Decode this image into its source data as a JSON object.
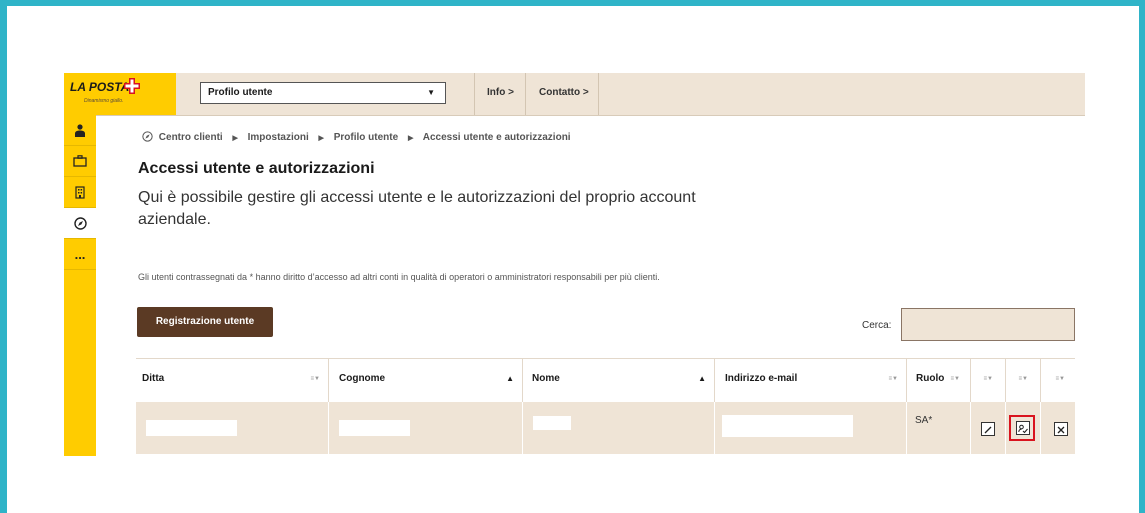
{
  "brand": {
    "name": "LA POSTA",
    "tagline": "Dinamismo giallo.",
    "accent": "#ffcc00",
    "cross_color": "#d9131e"
  },
  "header": {
    "profile_select": "Profilo utente",
    "nav": [
      "Info >",
      "Contatto >"
    ]
  },
  "sidebar": {
    "items": [
      {
        "icon": "person-icon"
      },
      {
        "icon": "briefcase-icon"
      },
      {
        "icon": "building-icon"
      },
      {
        "icon": "compass-icon",
        "active": true
      },
      {
        "icon": "more-icon",
        "label": "..."
      }
    ]
  },
  "breadcrumb": {
    "items": [
      "Centro clienti",
      "Impostazioni",
      "Profilo utente",
      "Accessi utente e autorizzazioni"
    ]
  },
  "page": {
    "title": "Accessi utente e autorizzazioni",
    "description": "Qui è possibile gestire gli accessi utente e le autorizzazioni del proprio account aziendale.",
    "note": "Gli utenti contrassegnati da * hanno diritto d’accesso ad altri conti in qualità di operatori o amministratori responsabili per più clienti."
  },
  "actions": {
    "register_user": "Registrazione utente"
  },
  "search": {
    "label": "Cerca:",
    "value": ""
  },
  "table": {
    "columns": [
      "Ditta",
      "Cognome",
      "Nome",
      "Indirizzo e-mail",
      "Ruolo",
      "",
      "",
      ""
    ],
    "rows": [
      {
        "ditta": "",
        "cognome": "",
        "nome": "",
        "email": "",
        "ruolo": "SA*"
      }
    ]
  }
}
